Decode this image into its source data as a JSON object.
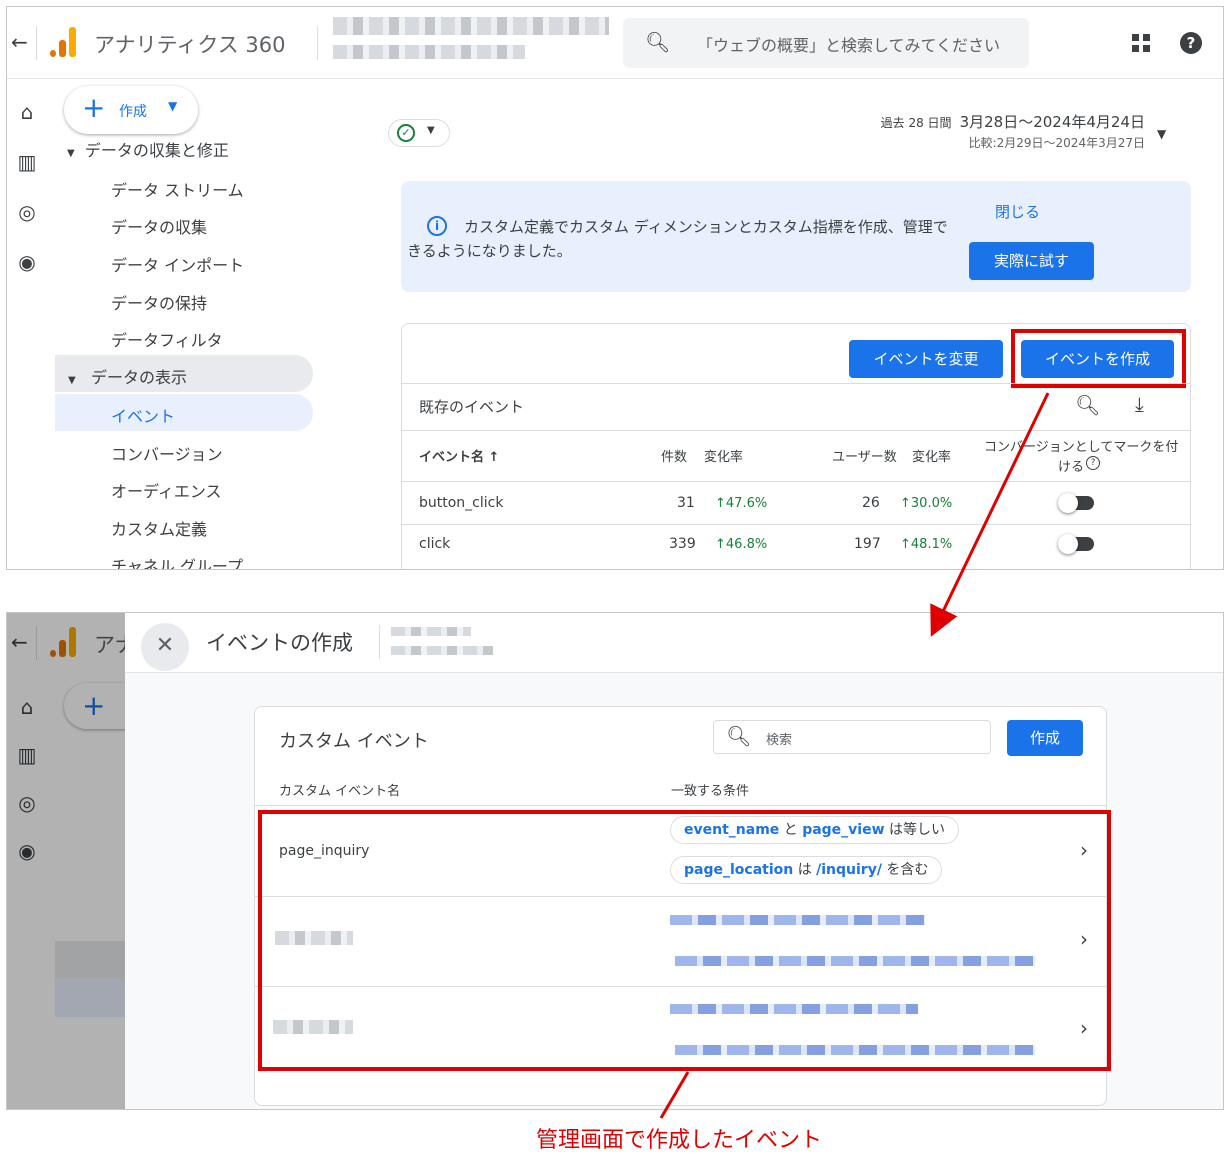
{
  "top": {
    "app_title": "アナリティクス 360",
    "search_placeholder": "「ウェブの概要」と検索してみてください",
    "create_label": "作成",
    "nav": {
      "section_collect": "データの収集と修正",
      "items_collect": [
        "データ ストリーム",
        "データの収集",
        "データ インポート",
        "データの保持",
        "データフィルタ"
      ],
      "section_display": "データの表示",
      "items_display": [
        "イベント",
        "コンバージョン",
        "オーディエンス",
        "カスタム定義",
        "チャネル グループ"
      ]
    },
    "date": {
      "period_label": "過去 28 日間",
      "range": "3月28日～2024年4月24日",
      "compare": "比較:2月29日～2024年3月27日"
    },
    "banner": {
      "message": "カスタム定義でカスタム ディメンションとカスタム指標を作成、管理できるようになりました。",
      "close": "閉じる",
      "try": "実際に試す"
    },
    "modify_event": "イベントを変更",
    "create_event": "イベントを作成",
    "existing_events": "既存のイベント",
    "table": {
      "headers": {
        "name": "イベント名 ↑",
        "count": "件数",
        "count_change": "変化率",
        "users": "ユーザー数",
        "users_change": "変化率",
        "mark_conversion_1": "コンバージョンとしてマークを付",
        "mark_conversion_2": "ける"
      },
      "rows": [
        {
          "name": "button_click",
          "count": "31",
          "count_change": "47.6%",
          "users": "26",
          "users_change": "30.0%"
        },
        {
          "name": "click",
          "count": "339",
          "count_change": "46.8%",
          "users": "197",
          "users_change": "48.1%"
        }
      ]
    }
  },
  "bottom": {
    "app_title_partial": "アナ",
    "drawer_title": "イベントの作成",
    "card_title": "カスタム イベント",
    "search_placeholder": "検索",
    "create": "作成",
    "col_name": "カスタム イベント名",
    "col_condition": "一致する条件",
    "rows": [
      {
        "name": "page_inquiry",
        "cond1": {
          "param": "event_name",
          "op": "と",
          "value": "page_view",
          "rel": "は等しい"
        },
        "cond2": {
          "param": "page_location",
          "op": "は",
          "value": "/inquiry/",
          "rel": "を含む"
        }
      }
    ]
  },
  "caption": "管理画面で作成したイベント",
  "colors": {
    "accent": "#1a73e8",
    "annotation_red": "#e00000",
    "positive": "#188038"
  },
  "icons": [
    "back-arrow-icon",
    "analytics-logo",
    "search-icon",
    "apps-grid-icon",
    "help-icon",
    "home-icon",
    "reports-icon",
    "explore-icon",
    "advertising-icon",
    "check-circle-icon",
    "info-icon",
    "download-icon",
    "close-icon",
    "chevron-right-icon"
  ]
}
